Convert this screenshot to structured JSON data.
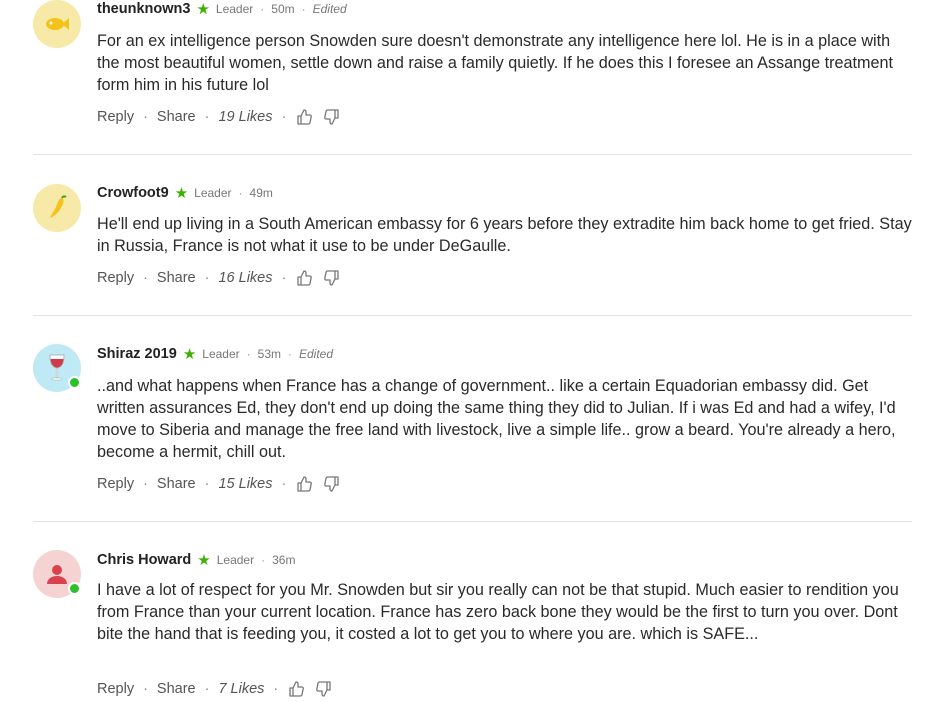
{
  "comments": [
    {
      "username": "theunknown3",
      "badge": "Leader",
      "time": "50m",
      "edited": "Edited",
      "text": "For an ex intelligence person Snowden sure doesn't demonstrate any intelligence here lol. He is in a place with the most beautiful women, settle down and raise a family quietly. If he does this I foresee an Assange treatment form him in his future lol",
      "reply": "Reply",
      "share": "Share",
      "likes": "19 Likes",
      "avatar_icon": "fish-icon",
      "avatar_color": "#f7e9a8",
      "online": false
    },
    {
      "username": "Crowfoot9",
      "badge": "Leader",
      "time": "49m",
      "edited": "",
      "text": "He'll end up living in a South American embassy for 6 years before they extradite him back home to get fried. Stay in Russia, France is not what it use to be under DeGaulle.",
      "reply": "Reply",
      "share": "Share",
      "likes": "16 Likes",
      "avatar_icon": "chili-pepper-icon",
      "avatar_color": "#f7e9a8",
      "online": false
    },
    {
      "username": "Shiraz 2019",
      "badge": "Leader",
      "time": "53m",
      "edited": "Edited",
      "text": "..and what happens when France has a change of government.. like a certain Equadorian embassy did. Get written assurances Ed, they don't end up doing the same thing they did to Julian. If i was Ed and had a wifey, I'd move to Siberia and manage the free land with livestock, live a simple life.. grow a beard. You're already a hero, become a hermit, chill out.",
      "reply": "Reply",
      "share": "Share",
      "likes": "15 Likes",
      "avatar_icon": "wine-glass-icon",
      "avatar_color": "#bfe9f4",
      "online": true
    },
    {
      "username": "Chris Howard",
      "badge": "Leader",
      "time": "36m",
      "edited": "",
      "text": "I have a lot of respect for you Mr. Snowden but sir you really can not be that stupid. Much easier to rendition you from France than your current location. France has zero back bone they would be the first to turn you over. Dont bite the hand that is feeding you, it costed a lot to get you to where you are. which is SAFE...",
      "reply": "Reply",
      "share": "Share",
      "likes": "7 Likes",
      "avatar_icon": "user-silhouette-icon",
      "avatar_color": "#f6d3d3",
      "online": true
    }
  ],
  "colors": {
    "star": "#3fb000",
    "online": "#2bc12b",
    "divider": "#e3e3e3"
  }
}
